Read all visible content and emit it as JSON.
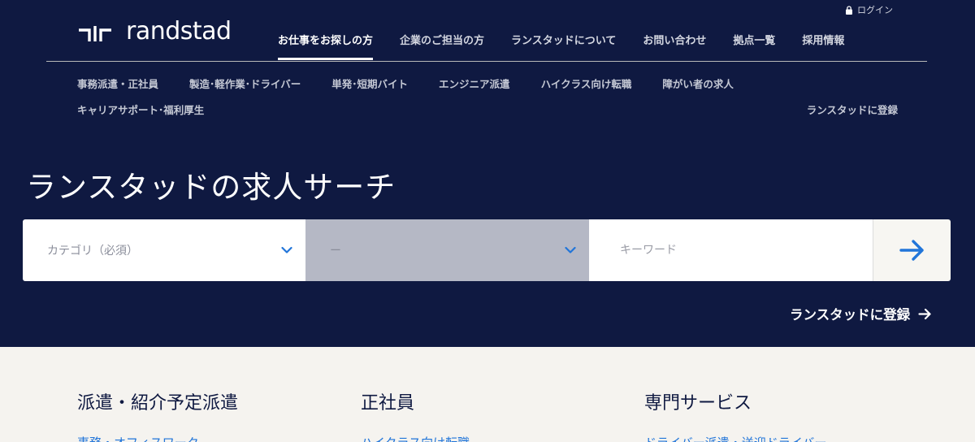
{
  "header": {
    "login_label": "ログイン",
    "logo_text": "randstad",
    "nav": [
      {
        "label": "お仕事をお探しの方",
        "active": true
      },
      {
        "label": "企業のご担当の方"
      },
      {
        "label": "ランスタッドについて"
      },
      {
        "label": "お問い合わせ"
      },
      {
        "label": "拠点一覧"
      },
      {
        "label": "採用情報"
      }
    ],
    "subnav_row1": [
      "事務派遣・正社員",
      "製造･軽作業･ドライバー",
      "単発･短期バイト",
      "エンジニア派遣",
      "ハイクラス向け転職",
      "障がい者の求人"
    ],
    "subnav_row2": [
      "キャリアサポート･福利厚生"
    ],
    "subnav_register": "ランスタッドに登録"
  },
  "hero": {
    "title": "ランスタッドの求人サーチ"
  },
  "search": {
    "category_placeholder": "カテゴリ（必須）",
    "sub_placeholder": "ー",
    "keyword_placeholder": "キーワード"
  },
  "register_link": "ランスタッドに登録",
  "columns": [
    {
      "heading": "派遣・紹介予定派遣",
      "first_link": "事務・オフィスワーク"
    },
    {
      "heading": "正社員",
      "first_link": "ハイクラス向け転職"
    },
    {
      "heading": "専門サービス",
      "first_link": "ドライバー派遣・送迎ドライバー"
    }
  ],
  "colors": {
    "navy": "#0f1941",
    "accent_blue": "#2175d9",
    "light_bg": "#f5f3ef"
  }
}
